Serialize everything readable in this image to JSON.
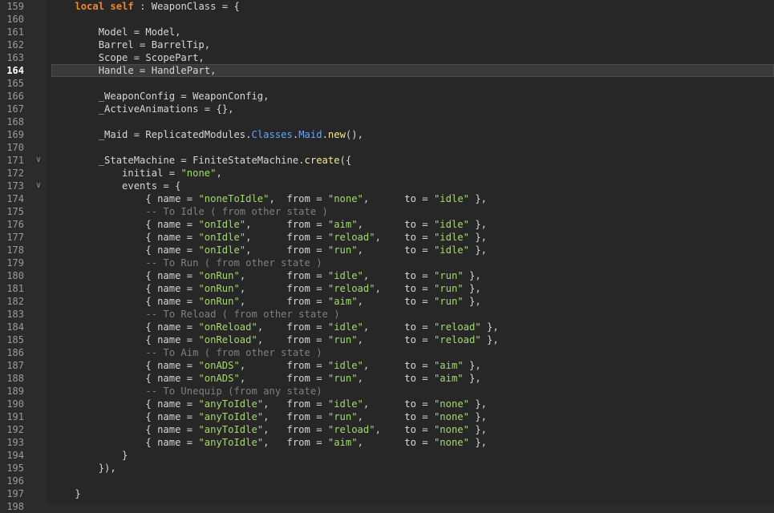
{
  "editor": {
    "colors": {
      "background": "#272727",
      "gutter": "#2b2b2b",
      "keyword": "#f0862c",
      "string": "#a6d96c",
      "comment": "#7f7f7f",
      "class_ref": "#5ea5ff",
      "function": "#f3e78a",
      "text": "#d6d6d6"
    },
    "current_line": 164,
    "lines": [
      {
        "n": "159",
        "fold": false,
        "tokens": [
          {
            "t": "    "
          },
          {
            "t": "local",
            "c": "kw"
          },
          {
            "t": " "
          },
          {
            "t": "self",
            "c": "kw"
          },
          {
            "t": " : WeaponClass = {"
          }
        ]
      },
      {
        "n": "160",
        "fold": false,
        "tokens": [
          {
            "t": ""
          }
        ]
      },
      {
        "n": "161",
        "fold": false,
        "tokens": [
          {
            "t": "        Model = Model,"
          }
        ]
      },
      {
        "n": "162",
        "fold": false,
        "tokens": [
          {
            "t": "        Barrel = BarrelTip,"
          }
        ]
      },
      {
        "n": "163",
        "fold": false,
        "tokens": [
          {
            "t": "        Scope = ScopePart,"
          }
        ]
      },
      {
        "n": "164",
        "fold": false,
        "tokens": [
          {
            "t": "        Handle = HandlePart,"
          }
        ]
      },
      {
        "n": "165",
        "fold": false,
        "tokens": [
          {
            "t": ""
          }
        ]
      },
      {
        "n": "166",
        "fold": false,
        "tokens": [
          {
            "t": "        _WeaponConfig = WeaponConfig,"
          }
        ]
      },
      {
        "n": "167",
        "fold": false,
        "tokens": [
          {
            "t": "        _ActiveAnimations = {},"
          }
        ]
      },
      {
        "n": "168",
        "fold": false,
        "tokens": [
          {
            "t": ""
          }
        ]
      },
      {
        "n": "169",
        "fold": false,
        "tokens": [
          {
            "t": "        _Maid = ReplicatedModules."
          },
          {
            "t": "Classes",
            "c": "cls"
          },
          {
            "t": "."
          },
          {
            "t": "Maid",
            "c": "cls"
          },
          {
            "t": "."
          },
          {
            "t": "new",
            "c": "fn"
          },
          {
            "t": "(),"
          }
        ]
      },
      {
        "n": "170",
        "fold": false,
        "tokens": [
          {
            "t": ""
          }
        ]
      },
      {
        "n": "171",
        "fold": true,
        "tokens": [
          {
            "t": "        _StateMachine = FiniteStateMachine."
          },
          {
            "t": "create",
            "c": "fn"
          },
          {
            "t": "({"
          }
        ]
      },
      {
        "n": "172",
        "fold": false,
        "tokens": [
          {
            "t": "            initial = "
          },
          {
            "t": "\"none\"",
            "c": "str"
          },
          {
            "t": ","
          }
        ]
      },
      {
        "n": "173",
        "fold": true,
        "tokens": [
          {
            "t": "            events = {"
          }
        ]
      },
      {
        "n": "174",
        "fold": false,
        "tokens": [
          {
            "t": "                { name = "
          },
          {
            "t": "\"noneToIdle\"",
            "c": "str"
          },
          {
            "t": ",  from = "
          },
          {
            "t": "\"none\"",
            "c": "str"
          },
          {
            "t": ",      to = "
          },
          {
            "t": "\"idle\"",
            "c": "str"
          },
          {
            "t": " },"
          }
        ]
      },
      {
        "n": "175",
        "fold": false,
        "tokens": [
          {
            "t": "                "
          },
          {
            "t": "-- To Idle ( from other state )",
            "c": "cmt"
          }
        ]
      },
      {
        "n": "176",
        "fold": false,
        "tokens": [
          {
            "t": "                { name = "
          },
          {
            "t": "\"onIdle\"",
            "c": "str"
          },
          {
            "t": ",      from = "
          },
          {
            "t": "\"aim\"",
            "c": "str"
          },
          {
            "t": ",       to = "
          },
          {
            "t": "\"idle\"",
            "c": "str"
          },
          {
            "t": " },"
          }
        ]
      },
      {
        "n": "177",
        "fold": false,
        "tokens": [
          {
            "t": "                { name = "
          },
          {
            "t": "\"onIdle\"",
            "c": "str"
          },
          {
            "t": ",      from = "
          },
          {
            "t": "\"reload\"",
            "c": "str"
          },
          {
            "t": ",    to = "
          },
          {
            "t": "\"idle\"",
            "c": "str"
          },
          {
            "t": " },"
          }
        ]
      },
      {
        "n": "178",
        "fold": false,
        "tokens": [
          {
            "t": "                { name = "
          },
          {
            "t": "\"onIdle\"",
            "c": "str"
          },
          {
            "t": ",      from = "
          },
          {
            "t": "\"run\"",
            "c": "str"
          },
          {
            "t": ",       to = "
          },
          {
            "t": "\"idle\"",
            "c": "str"
          },
          {
            "t": " },"
          }
        ]
      },
      {
        "n": "179",
        "fold": false,
        "tokens": [
          {
            "t": "                "
          },
          {
            "t": "-- To Run ( from other state )",
            "c": "cmt"
          }
        ]
      },
      {
        "n": "180",
        "fold": false,
        "tokens": [
          {
            "t": "                { name = "
          },
          {
            "t": "\"onRun\"",
            "c": "str"
          },
          {
            "t": ",       from = "
          },
          {
            "t": "\"idle\"",
            "c": "str"
          },
          {
            "t": ",      to = "
          },
          {
            "t": "\"run\"",
            "c": "str"
          },
          {
            "t": " },"
          }
        ]
      },
      {
        "n": "181",
        "fold": false,
        "tokens": [
          {
            "t": "                { name = "
          },
          {
            "t": "\"onRun\"",
            "c": "str"
          },
          {
            "t": ",       from = "
          },
          {
            "t": "\"reload\"",
            "c": "str"
          },
          {
            "t": ",    to = "
          },
          {
            "t": "\"run\"",
            "c": "str"
          },
          {
            "t": " },"
          }
        ]
      },
      {
        "n": "182",
        "fold": false,
        "tokens": [
          {
            "t": "                { name = "
          },
          {
            "t": "\"onRun\"",
            "c": "str"
          },
          {
            "t": ",       from = "
          },
          {
            "t": "\"aim\"",
            "c": "str"
          },
          {
            "t": ",       to = "
          },
          {
            "t": "\"run\"",
            "c": "str"
          },
          {
            "t": " },"
          }
        ]
      },
      {
        "n": "183",
        "fold": false,
        "tokens": [
          {
            "t": "                "
          },
          {
            "t": "-- To Reload ( from other state )",
            "c": "cmt"
          }
        ]
      },
      {
        "n": "184",
        "fold": false,
        "tokens": [
          {
            "t": "                { name = "
          },
          {
            "t": "\"onReload\"",
            "c": "str"
          },
          {
            "t": ",    from = "
          },
          {
            "t": "\"idle\"",
            "c": "str"
          },
          {
            "t": ",      to = "
          },
          {
            "t": "\"reload\"",
            "c": "str"
          },
          {
            "t": " },"
          }
        ]
      },
      {
        "n": "185",
        "fold": false,
        "tokens": [
          {
            "t": "                { name = "
          },
          {
            "t": "\"onReload\"",
            "c": "str"
          },
          {
            "t": ",    from = "
          },
          {
            "t": "\"run\"",
            "c": "str"
          },
          {
            "t": ",       to = "
          },
          {
            "t": "\"reload\"",
            "c": "str"
          },
          {
            "t": " },"
          }
        ]
      },
      {
        "n": "186",
        "fold": false,
        "tokens": [
          {
            "t": "                "
          },
          {
            "t": "-- To Aim ( from other state )",
            "c": "cmt"
          }
        ]
      },
      {
        "n": "187",
        "fold": false,
        "tokens": [
          {
            "t": "                { name = "
          },
          {
            "t": "\"onADS\"",
            "c": "str"
          },
          {
            "t": ",       from = "
          },
          {
            "t": "\"idle\"",
            "c": "str"
          },
          {
            "t": ",      to = "
          },
          {
            "t": "\"aim\"",
            "c": "str"
          },
          {
            "t": " },"
          }
        ]
      },
      {
        "n": "188",
        "fold": false,
        "tokens": [
          {
            "t": "                { name = "
          },
          {
            "t": "\"onADS\"",
            "c": "str"
          },
          {
            "t": ",       from = "
          },
          {
            "t": "\"run\"",
            "c": "str"
          },
          {
            "t": ",       to = "
          },
          {
            "t": "\"aim\"",
            "c": "str"
          },
          {
            "t": " },"
          }
        ]
      },
      {
        "n": "189",
        "fold": false,
        "tokens": [
          {
            "t": "                "
          },
          {
            "t": "-- To Unequip (from any state)",
            "c": "cmt"
          }
        ]
      },
      {
        "n": "190",
        "fold": false,
        "tokens": [
          {
            "t": "                { name = "
          },
          {
            "t": "\"anyToIdle\"",
            "c": "str"
          },
          {
            "t": ",   from = "
          },
          {
            "t": "\"idle\"",
            "c": "str"
          },
          {
            "t": ",      to = "
          },
          {
            "t": "\"none\"",
            "c": "str"
          },
          {
            "t": " },"
          }
        ]
      },
      {
        "n": "191",
        "fold": false,
        "tokens": [
          {
            "t": "                { name = "
          },
          {
            "t": "\"anyToIdle\"",
            "c": "str"
          },
          {
            "t": ",   from = "
          },
          {
            "t": "\"run\"",
            "c": "str"
          },
          {
            "t": ",       to = "
          },
          {
            "t": "\"none\"",
            "c": "str"
          },
          {
            "t": " },"
          }
        ]
      },
      {
        "n": "192",
        "fold": false,
        "tokens": [
          {
            "t": "                { name = "
          },
          {
            "t": "\"anyToIdle\"",
            "c": "str"
          },
          {
            "t": ",   from = "
          },
          {
            "t": "\"reload\"",
            "c": "str"
          },
          {
            "t": ",    to = "
          },
          {
            "t": "\"none\"",
            "c": "str"
          },
          {
            "t": " },"
          }
        ]
      },
      {
        "n": "193",
        "fold": false,
        "tokens": [
          {
            "t": "                { name = "
          },
          {
            "t": "\"anyToIdle\"",
            "c": "str"
          },
          {
            "t": ",   from = "
          },
          {
            "t": "\"aim\"",
            "c": "str"
          },
          {
            "t": ",       to = "
          },
          {
            "t": "\"none\"",
            "c": "str"
          },
          {
            "t": " },"
          }
        ]
      },
      {
        "n": "194",
        "fold": false,
        "tokens": [
          {
            "t": "            }"
          }
        ]
      },
      {
        "n": "195",
        "fold": false,
        "tokens": [
          {
            "t": "        }),"
          }
        ]
      },
      {
        "n": "196",
        "fold": false,
        "tokens": [
          {
            "t": ""
          }
        ]
      },
      {
        "n": "197",
        "fold": false,
        "tokens": [
          {
            "t": "    }"
          }
        ]
      },
      {
        "n": "198",
        "fold": false,
        "tokens": [
          {
            "t": ""
          }
        ]
      }
    ]
  }
}
